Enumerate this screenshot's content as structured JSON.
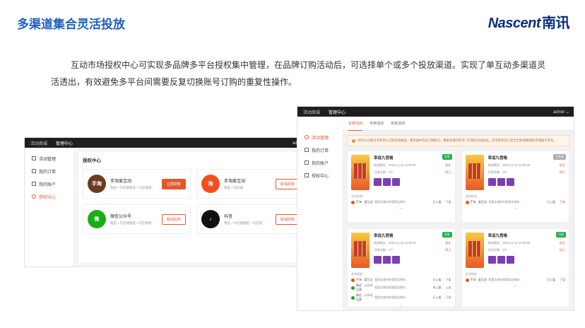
{
  "slide": {
    "title": "多渠道集合灵活投放",
    "logo_en": "Nascent",
    "logo_cn": "南讯",
    "description": "互动市场授权中心可实现多品牌多平台授权集中管理，在品牌订购活动后，可选择单个或多个投放渠道。实现了单互动多渠道灵活透出，有效避免多平台间需要反复切换账号订购的重复性操作。"
  },
  "auth_window": {
    "tabs": [
      "活动商城",
      "管理中心"
    ],
    "user": "admin",
    "sidebar": [
      "活动管理",
      "我的订单",
      "我的账户",
      "授权中心"
    ],
    "panel_title": "授权中心",
    "platforms": [
      {
        "name": "手淘爱互动",
        "desc": "我是一句店铺我是一句店铺我…",
        "button": "立即授权",
        "color": "#6b3a1f",
        "logo": "手淘"
      },
      {
        "name": "手淘爱互动",
        "desc": "我是二句店铺",
        "button": "取消授权",
        "color": "#f0501e",
        "logo": "淘"
      },
      {
        "name": "微信公众号",
        "desc": "我是一句店铺我是一句店铺我…",
        "button": "取消授权",
        "color": "#1aad19",
        "logo": "微"
      },
      {
        "name": "抖音",
        "desc": "我是一句店铺我是一句店铺…",
        "button": "取消授权",
        "color": "#111111",
        "logo": "♪"
      }
    ]
  },
  "activity_window": {
    "tabs": [
      "活动商城",
      "管理中心"
    ],
    "user": "admin",
    "sidebar": [
      "活动管理",
      "我的订单",
      "我的账户",
      "授权中心"
    ],
    "content_tabs": [
      "全部活动",
      "可用活动",
      "失效活动"
    ],
    "notice": "所有公司账号可共享以订购活动商品，使页面中仅分订购账号。哪家店铺均有专门订购的活动商品，您可将活动上架至全部/将管理的店铺账号平台。",
    "cards": [
      {
        "name": "幸运九宫格",
        "badge": "可用",
        "badge_gray": false,
        "period_label": "有效期至：",
        "period": "2022-12-12 12:00:00",
        "action1": "延长",
        "count_label": "可用次数：",
        "count": "3个",
        "action2": "续订",
        "channels_label": "支持投放：",
        "channels": [
          {
            "name": "手淘 · 爱互动",
            "shop": "我是店铺名称我是店铺名…",
            "status": "已上架",
            "action": "下架",
            "color": "#f0501e"
          }
        ]
      },
      {
        "name": "幸运九宫格",
        "badge": "已失效",
        "badge_gray": true,
        "period_label": "有效期至：",
        "period": "2022-12-12 12:00:00",
        "action1": "延长",
        "count_label": "可用次数：",
        "count": "3个",
        "action2": "续订",
        "channels_label": "支持投放：",
        "channels": [
          {
            "name": "手淘 · 爱互动",
            "shop": "我是店铺名称我是店铺名…",
            "status": "已上架",
            "action": "下架",
            "color": "#f0501e"
          }
        ]
      },
      {
        "name": "幸运九宫格",
        "badge": "可用",
        "badge_gray": false,
        "period_label": "有效期至：",
        "period": "2022-12-12 12:00:00",
        "action1": "延长",
        "count_label": "可用次数：",
        "count": "3个",
        "action2": "续订",
        "channels_label": "支持投放：",
        "channels": [
          {
            "name": "手淘 · 爱互动",
            "shop": "我是店铺名称我是店铺名…",
            "status": "已上架",
            "action": "下架",
            "color": "#f0501e"
          },
          {
            "name": "微信 · 公众号运营",
            "shop": "我是店铺名称我是店铺名…",
            "status": "未上架",
            "action": "上架",
            "color": "#1aad19"
          },
          {
            "name": "微信 · 公众号运营",
            "shop": "我是店铺名称我是店铺名…",
            "status": "已上架",
            "action": "下架",
            "color": "#1aad19"
          }
        ]
      },
      {
        "name": "幸运九宫格",
        "badge": "可用",
        "badge_gray": false,
        "period_label": "有效期至：",
        "period": "2022-12-12 12:00:00",
        "action1": "延长",
        "count_label": "可用次数：",
        "count": "3个",
        "action2": "续订",
        "channels_label": "支持投放：",
        "channels": [
          {
            "name": "手淘 · 爱互动",
            "shop": "我是店铺名称我是店铺名…",
            "status": "已上架",
            "action": "下架",
            "color": "#f0501e"
          }
        ]
      }
    ]
  }
}
